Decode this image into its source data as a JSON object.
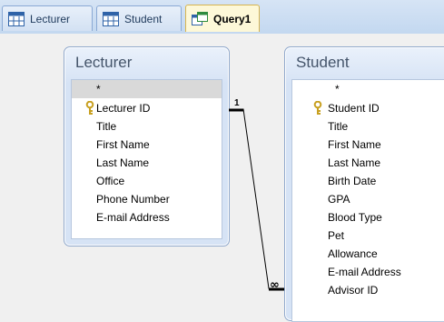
{
  "tabs": [
    {
      "label": "Lecturer",
      "active": false,
      "icon": "table-icon"
    },
    {
      "label": "Student",
      "active": false,
      "icon": "table-icon"
    },
    {
      "label": "Query1",
      "active": true,
      "icon": "query-icon"
    }
  ],
  "tables": {
    "lecturer": {
      "title": "Lecturer",
      "fields": [
        "*",
        "Lecturer ID",
        "Title",
        "First Name",
        "Last Name",
        "Office",
        "Phone Number",
        "E-mail Address"
      ],
      "key_field": "Lecturer ID"
    },
    "student": {
      "title": "Student",
      "fields": [
        "*",
        "Student ID",
        "Title",
        "First Name",
        "Last Name",
        "Birth Date",
        "GPA",
        "Blood Type",
        "Pet",
        "Allowance",
        "E-mail Address",
        "Advisor ID"
      ],
      "key_field": "Student ID"
    }
  },
  "relationship": {
    "one_label": "1",
    "many_label": "∞"
  },
  "colors": {
    "tab_active_bg": "#fdf8d8",
    "key_icon": "#c8a020",
    "table_border": "#8fa8cc"
  }
}
